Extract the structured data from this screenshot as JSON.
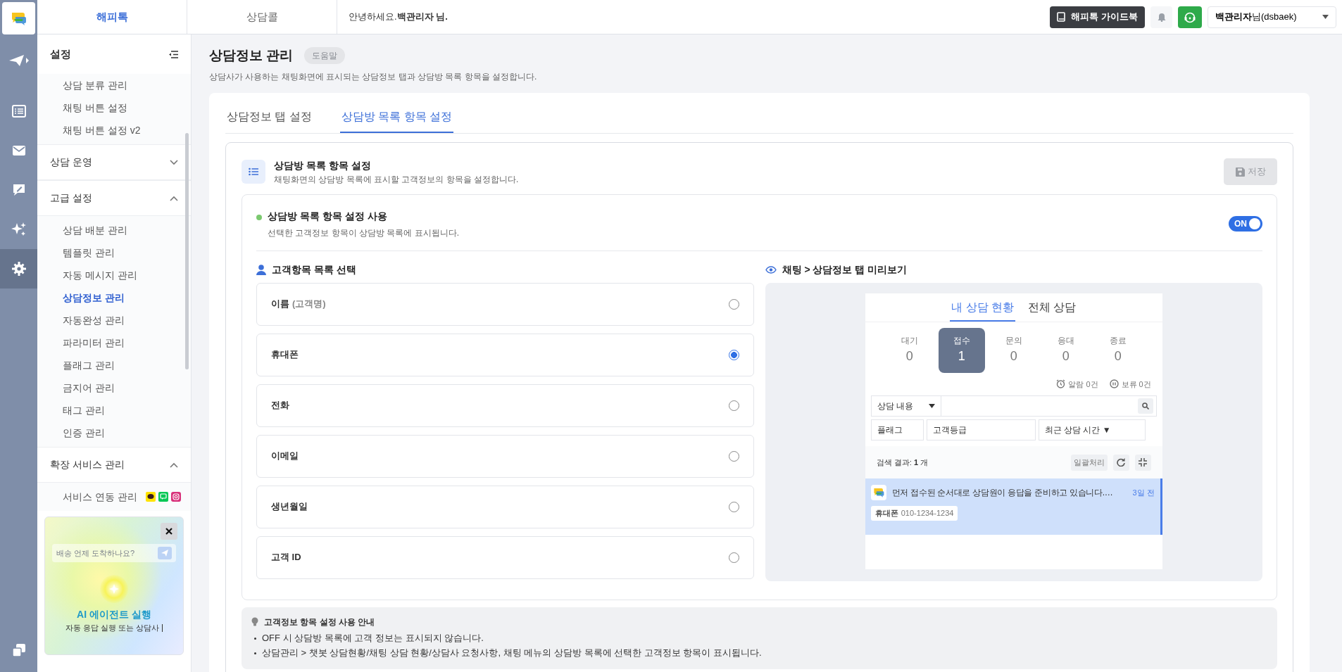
{
  "rail": [
    {
      "selected": false
    },
    {
      "selected": false
    },
    {
      "selected": false
    },
    {
      "selected": false
    },
    {
      "selected": false
    },
    {
      "selected": true
    },
    {
      "selected": false
    }
  ],
  "topbar": {
    "tabs": [
      {
        "label": "해피톡",
        "selected": true
      },
      {
        "label": "상담콜",
        "selected": false
      }
    ],
    "greeting": "안녕하세요.**백관리자 님.**",
    "guide_button": "해피톡 가이드북",
    "user": "**백관리자**님(dsbaek)"
  },
  "sidebar": {
    "title": "설정",
    "groups": [
      {
        "items": [
          {
            "label": "상담 분류 관리",
            "selected": false
          },
          {
            "label": "채팅 버튼 설정",
            "selected": false
          },
          {
            "label": "채팅 버튼 설정 v2",
            "selected": false
          }
        ]
      },
      {
        "label": "상담 운영",
        "expanded": false
      },
      {
        "label": "고급 설정",
        "expanded": true,
        "items": [
          {
            "label": "상담 배분 관리",
            "selected": false
          },
          {
            "label": "템플릿 관리",
            "selected": false
          },
          {
            "label": "자동 메시지 관리",
            "selected": false
          },
          {
            "label": "상담정보 관리",
            "selected": true
          },
          {
            "label": "자동완성 관리",
            "selected": false
          },
          {
            "label": "파라미터 관리",
            "selected": false
          },
          {
            "label": "플래그 관리",
            "selected": false
          },
          {
            "label": "금지어 관리",
            "selected": false
          },
          {
            "label": "태그 관리",
            "selected": false
          },
          {
            "label": "인증 관리",
            "selected": false
          }
        ]
      },
      {
        "label": "확장 서비스 관리",
        "expanded": true,
        "items": [
          {
            "label": "서비스 연동 관리",
            "selected": false
          }
        ]
      }
    ],
    "banner": {
      "prompt": "배송 언제 도착하나요?",
      "title": "AI 에이전트 실행",
      "subtitle": "자동 응답 실행 또는 상담사"
    }
  },
  "page": {
    "title": "상담정보 관리",
    "help": "도움말",
    "description": "상담사가 사용하는 채팅화면에 표시되는 상담정보 탭과 상담방 목록 항목을 설정합니다."
  },
  "tabs": [
    {
      "label": "상담정보 탭 설정",
      "selected": false
    },
    {
      "label": "상담방 목록 항목 설정",
      "selected": true
    }
  ],
  "section": {
    "title": "상담방 목록 항목 설정",
    "description": "채팅화면의 상담방 목록에 표시할 고객정보의 항목을 설정합니다.",
    "save_button": {
      "label": "저장",
      "disabled": true
    }
  },
  "usage": {
    "title": "상담방 목록 항목 설정 사용",
    "description": "선택한 고객정보 항목이 상담방 목록에 표시됩니다.",
    "toggle": {
      "label": "ON",
      "on": true
    }
  },
  "fields": {
    "title": "고객항목 목록 선택",
    "items": [
      {
        "label": "이름",
        "note": "(고객명)",
        "selected": false
      },
      {
        "label": "휴대폰",
        "selected": true
      },
      {
        "label": "전화",
        "selected": false
      },
      {
        "label": "이메일",
        "selected": false
      },
      {
        "label": "생년월일",
        "selected": false
      },
      {
        "label": "고객 ID",
        "selected": false
      }
    ]
  },
  "preview": {
    "title": "채팅 > 상담정보 탭 미리보기",
    "tabs": [
      {
        "label": "내 상담 현황",
        "selected": true
      },
      {
        "label": "전체 상담",
        "selected": false
      }
    ],
    "counters": [
      {
        "label": "대기",
        "value": "0",
        "selected": false
      },
      {
        "label": "접수",
        "value": "1",
        "selected": true
      },
      {
        "label": "문의",
        "value": "0",
        "selected": false
      },
      {
        "label": "응대",
        "value": "0",
        "selected": false
      },
      {
        "label": "종료",
        "value": "0",
        "selected": false
      }
    ],
    "alarm": "알람 0건",
    "hold": "보류 0건",
    "search_select": "상담 내용",
    "filters": [
      "플래그",
      "고객등급",
      "최근 상담 시간 ▼"
    ],
    "result": "검색 결과: **1** 개",
    "bulk_button": "일괄처리",
    "rooms": [
      {
        "message": "먼저 접수된 순서대로 상담원이 응답을 준비하고 있습니다.…",
        "time": "3일 전",
        "tag_label": "휴대폰",
        "tag_value": "010-1234-1234",
        "selected": true
      }
    ]
  },
  "notice": {
    "title": "고객정보 항목 설정 사용 안내",
    "items": [
      "OFF 시 상담방 목록에 고객 정보는 표시되지 않습니다.",
      "상담관리 > 챗봇 상담현황/채팅 상담 현황/상담사 요청사항, 채팅 메뉴의 상담방 목록에 선택한 고객정보 항목이 표시됩니다."
    ]
  }
}
